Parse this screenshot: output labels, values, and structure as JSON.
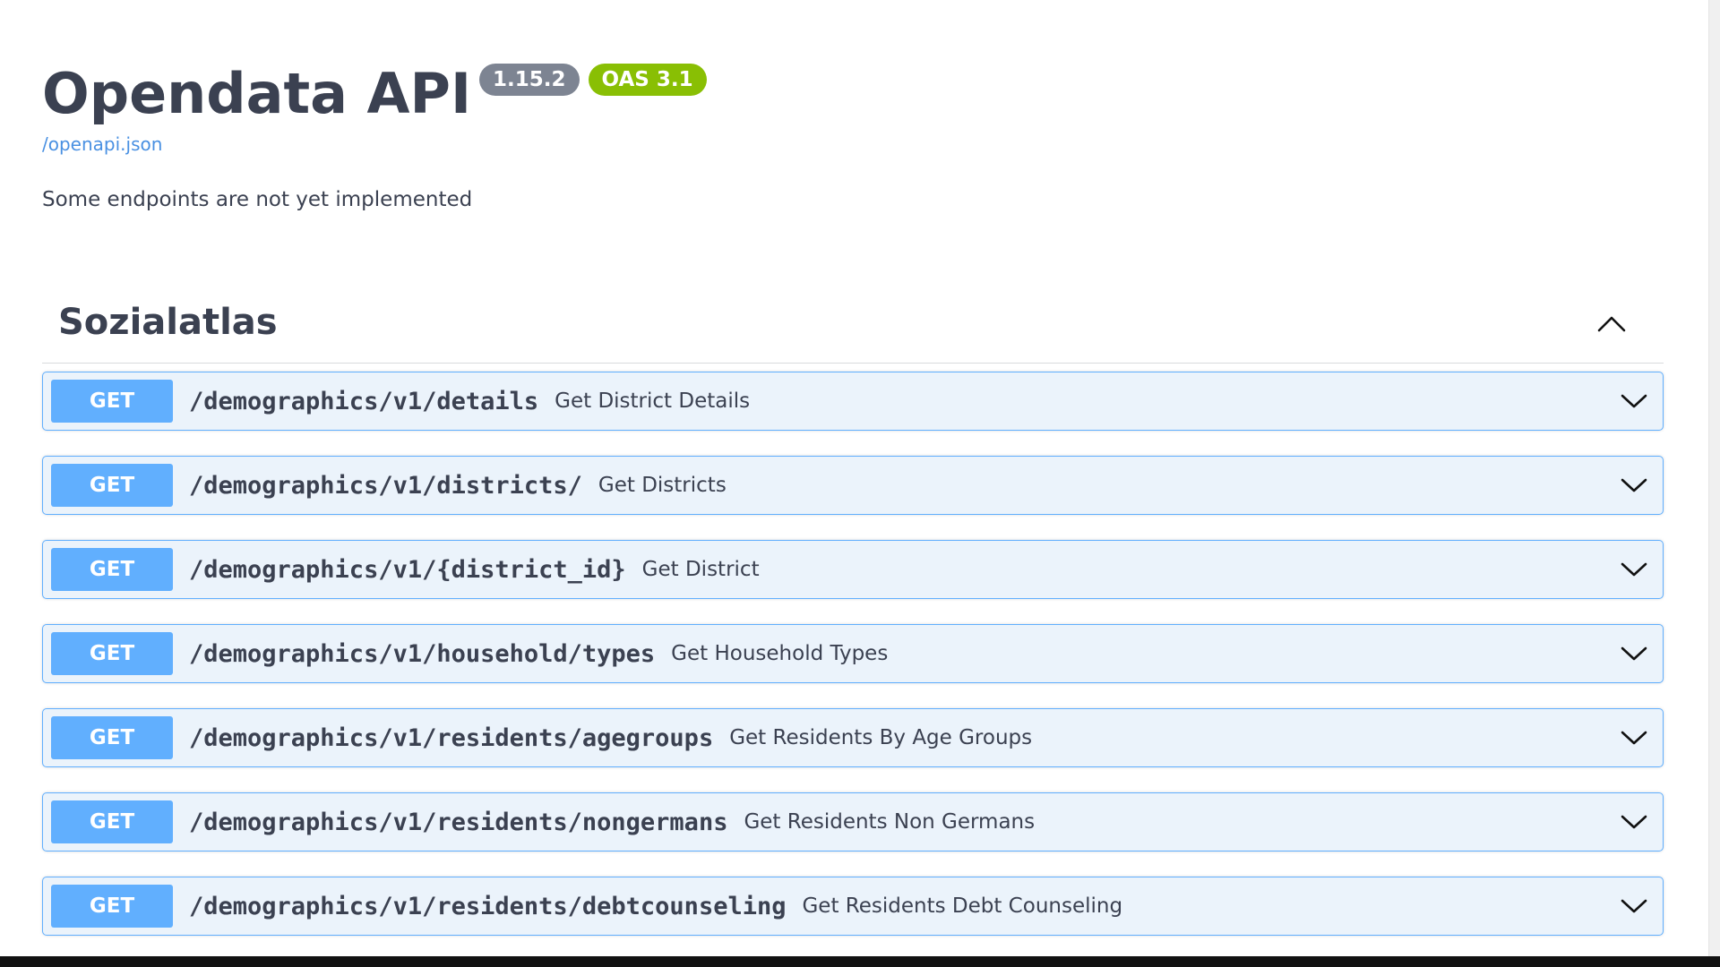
{
  "info": {
    "title": "Opendata API",
    "version_badge": "1.15.2",
    "oas_badge": "OAS 3.1",
    "spec_link": "/openapi.json",
    "description": "Some endpoints are not yet implemented"
  },
  "colors": {
    "get_method": "#61affe",
    "get_block_bg": "#ebf3fb",
    "version_badge": "#7d8492",
    "oas_badge": "#89bf04",
    "link": "#4990e2",
    "text": "#3b4151"
  },
  "tag": {
    "name": "Sozialatlas",
    "toggle_icon": "chevron-up-icon",
    "operations": [
      {
        "method": "GET",
        "path": "/demographics/v1/details",
        "summary": "Get District Details",
        "icon": "chevron-down-icon"
      },
      {
        "method": "GET",
        "path": "/demographics/v1/districts/",
        "summary": "Get Districts",
        "icon": "chevron-down-icon"
      },
      {
        "method": "GET",
        "path": "/demographics/v1/{district_id}",
        "summary": "Get District",
        "icon": "chevron-down-icon"
      },
      {
        "method": "GET",
        "path": "/demographics/v1/household/types",
        "summary": "Get Household Types",
        "icon": "chevron-down-icon"
      },
      {
        "method": "GET",
        "path": "/demographics/v1/residents/agegroups",
        "summary": "Get Residents By Age Groups",
        "icon": "chevron-down-icon"
      },
      {
        "method": "GET",
        "path": "/demographics/v1/residents/nongermans",
        "summary": "Get Residents Non Germans",
        "icon": "chevron-down-icon"
      },
      {
        "method": "GET",
        "path": "/demographics/v1/residents/debtcounseling",
        "summary": "Get Residents Debt Counseling",
        "icon": "chevron-down-icon"
      }
    ]
  }
}
